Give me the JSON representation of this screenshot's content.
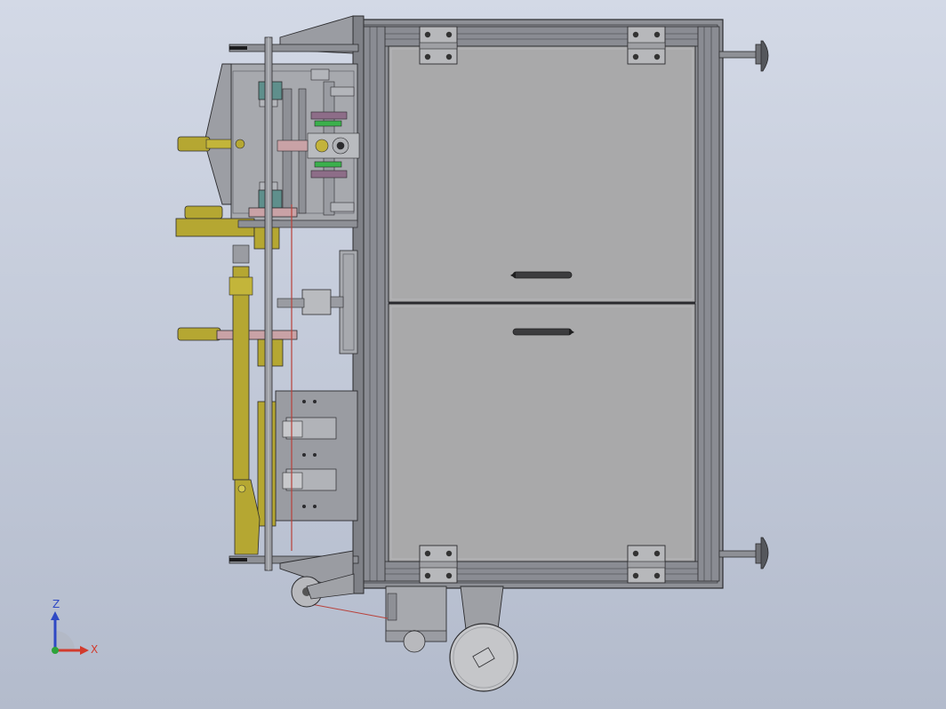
{
  "viewport": {
    "background_top": "#d3d9e6",
    "background_bottom": "#b3bbcc"
  },
  "colors": {
    "frame": "#8e9096",
    "panel": "#a9a9aa",
    "outline": "#2b2b2e",
    "brass": "#b5a732",
    "shaft": "#9a9ca2",
    "pink": "#c9a2a6",
    "teal": "#5f8f8c",
    "green": "#3bb04c"
  },
  "triad": {
    "z_label": "Z",
    "x_label": "X",
    "z_color": "#2f49c4",
    "x_color": "#d23b2d",
    "origin_color": "#2ea33a"
  },
  "model": {
    "parts": [
      "cabinet-frame",
      "upper-door-panel",
      "lower-door-panel",
      "door-handle-upper",
      "door-handle-lower",
      "hinge-top-left",
      "hinge-top-right",
      "hinge-bottom-left",
      "hinge-bottom-right",
      "leveling-foot-top",
      "leveling-foot-bottom",
      "drive-mechanism",
      "vertical-shaft",
      "lead-screw",
      "caster-wheel-large",
      "caster-wheel-small",
      "motor-bracket"
    ]
  }
}
